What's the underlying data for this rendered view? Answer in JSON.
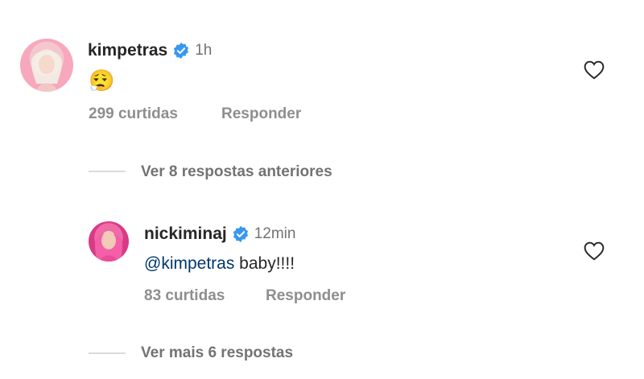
{
  "comment1": {
    "username": "kimpetras",
    "time": "1h",
    "text": "😮‍💨",
    "likes": "299 curtidas",
    "reply_label": "Responder"
  },
  "view_previous": "Ver 8 respostas anteriores",
  "comment2": {
    "username": "nickiminaj",
    "time": "12min",
    "mention": "@kimpetras",
    "text": " baby!!!!",
    "likes": "83 curtidas",
    "reply_label": "Responder"
  },
  "view_more": "Ver mais 6 respostas",
  "colors": {
    "verified": "#3897f0",
    "mention": "#00376b",
    "muted": "#737373"
  },
  "icons": [
    "verified-icon",
    "heart-icon"
  ]
}
